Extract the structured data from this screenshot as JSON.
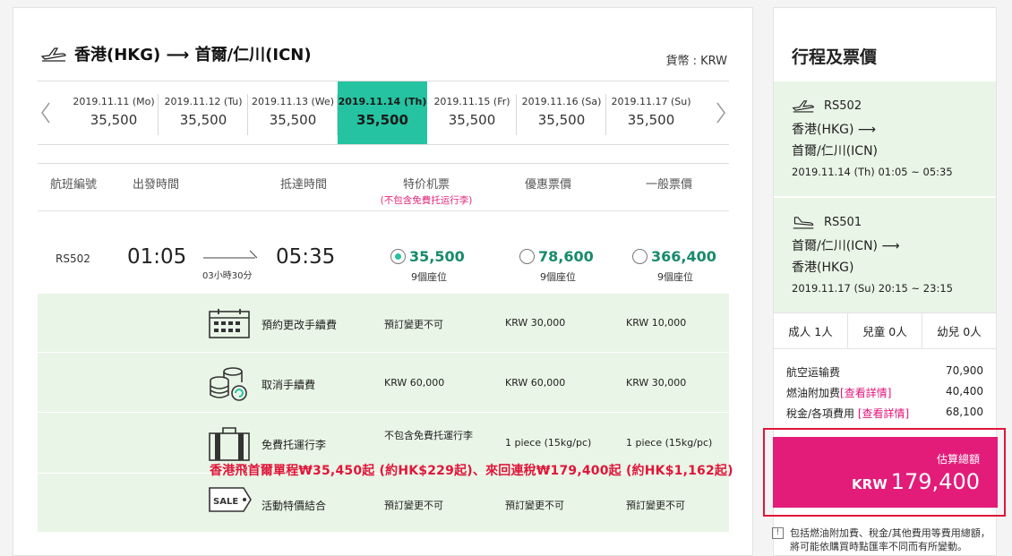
{
  "route": {
    "title": "香港(HKG) ⟶ 首爾/仁川(ICN)"
  },
  "currency_label": "貨幣 : KRW",
  "dates": [
    {
      "date": "2019.11.11 (Mo)",
      "price": "35,500"
    },
    {
      "date": "2019.11.12 (Tu)",
      "price": "35,500"
    },
    {
      "date": "2019.11.13 (We)",
      "price": "35,500"
    },
    {
      "date": "2019.11.14 (Th)",
      "price": "35,500"
    },
    {
      "date": "2019.11.15 (Fr)",
      "price": "35,500"
    },
    {
      "date": "2019.11.16 (Sa)",
      "price": "35,500"
    },
    {
      "date": "2019.11.17 (Su)",
      "price": "35,500"
    }
  ],
  "table_head": {
    "flight_no": "航班編號",
    "dep_time": "出發時間",
    "arr_time": "抵達時間",
    "special": "特价机票",
    "special_note": "(不包含免費托运行李)",
    "discount": "優惠票價",
    "regular": "一般票價"
  },
  "flight": {
    "number": "RS502",
    "dep": "01:05",
    "arr": "05:35",
    "duration": "03小時30分",
    "fares": [
      {
        "amount": "35,500",
        "seats": "9個座位"
      },
      {
        "amount": "78,600",
        "seats": "9個座位"
      },
      {
        "amount": "366,400",
        "seats": "9個座位"
      }
    ]
  },
  "details": [
    {
      "label": "預約更改手續費",
      "values": [
        "預訂變更不可",
        "KRW 30,000",
        "KRW 10,000"
      ]
    },
    {
      "label": "取消手續費",
      "values": [
        "KRW 60,000",
        "KRW 60,000",
        "KRW 30,000"
      ]
    },
    {
      "label": "免費托運行李",
      "values": [
        "不包含免費托運行李",
        "1 piece (15kg/pc)",
        "1 piece (15kg/pc)"
      ]
    },
    {
      "label": "活動特價結合",
      "values": [
        "預訂變更不可",
        "預訂變更不可",
        "預訂變更不可"
      ]
    }
  ],
  "sale_badge": "SALE",
  "overlay_text": "香港飛首爾單程₩35,450起 (約HK$229起)、來回連稅₩179,400起 (約HK$1,162起)",
  "summary": {
    "title": "行程及票價",
    "segments": [
      {
        "flight": "RS502",
        "route_line1": "香港(HKG) ⟶",
        "route_line2": "首爾/仁川(ICN)",
        "time": "2019.11.14 (Th) 01:05 ~ 05:35"
      },
      {
        "flight": "RS501",
        "route_line1": "首爾/仁川(ICN) ⟶",
        "route_line2": "香港(HKG)",
        "time": "2019.11.17 (Su) 20:15 ~ 23:15"
      }
    ],
    "pax": {
      "adult": "成人 1人",
      "child": "兒童 0人",
      "infant": "幼兒 0人"
    },
    "costs": [
      {
        "label": "航空运输费",
        "link": "",
        "value": "70,900"
      },
      {
        "label": "燃油附加费",
        "link": "[查看詳情]",
        "value": "40,400"
      },
      {
        "label": "稅金/各項費用",
        "link": "[查看詳情]",
        "value": "68,100"
      }
    ],
    "total_label": "估算總額",
    "total_currency": "KRW",
    "total_value": "179,400",
    "notice": "包括燃油附加費、稅金/其他費用等費用總額，將可能依購買時點匯率不同而有所變動。"
  },
  "colors": {
    "accent": "#25c3a1",
    "pink": "#e31c7a",
    "highlight_red": "#e0163a",
    "detail_bg": "#e9f5e6"
  }
}
